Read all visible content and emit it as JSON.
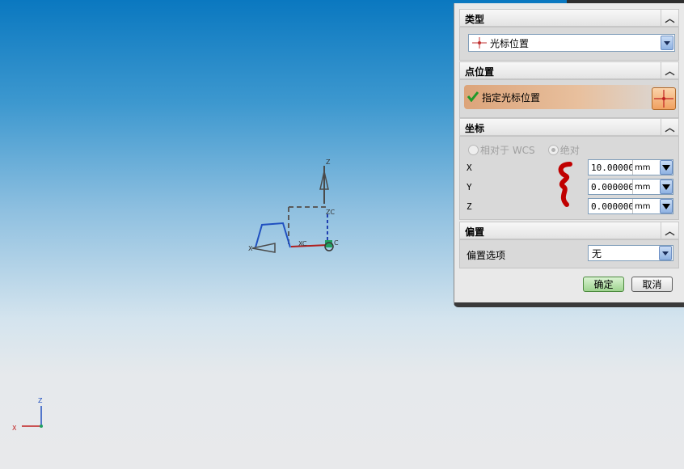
{
  "viewport": {
    "axes": {
      "zc": "ZC",
      "xc": "XC",
      "yc_label": "C",
      "x_label": "X",
      "z_label": "Z"
    },
    "triad": {
      "z_label": "Z",
      "x_label": "X"
    }
  },
  "dialog": {
    "type_section": {
      "title": "类型",
      "selected": "光标位置"
    },
    "point_section": {
      "title": "点位置",
      "specify_label": "指定光标位置"
    },
    "coords_section": {
      "title": "坐标",
      "radio_relative": "相对于 WCS",
      "radio_absolute": "绝对",
      "fields": [
        {
          "label": "X",
          "value": "10.000000",
          "unit": "mm"
        },
        {
          "label": "Y",
          "value": "0.0000000",
          "unit": "mm"
        },
        {
          "label": "Z",
          "value": "0.0000000",
          "unit": "mm"
        }
      ]
    },
    "offset_section": {
      "title": "偏置",
      "option_label": "偏置选项",
      "option_value": "无"
    },
    "ok_label": "确定",
    "cancel_label": "取消"
  },
  "colors": {
    "annotation_red": "#c00000",
    "ok_green": "#9ed38f",
    "accent_orange": "#f0a060"
  }
}
